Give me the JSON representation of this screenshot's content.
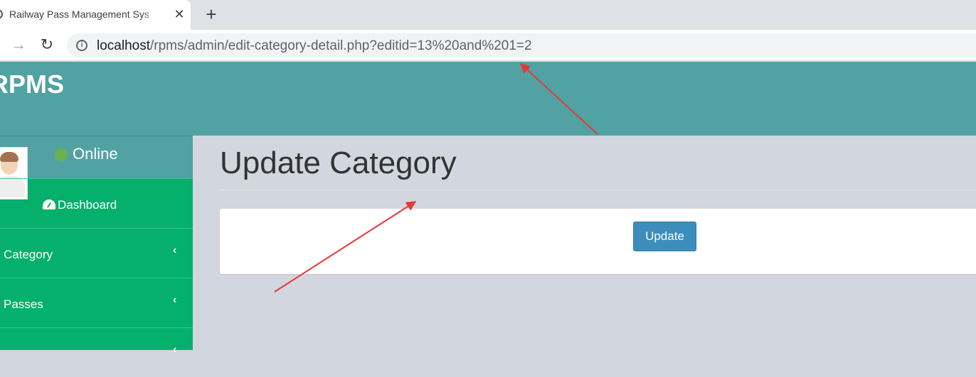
{
  "browser": {
    "tab_title": "Railway Pass Management Sys",
    "tab_close": "✕",
    "new_tab": "+",
    "forward": "→",
    "reload": "↻",
    "info": "i",
    "url_host": "localhost",
    "url_path": "/rpms/admin/edit-category-detail.php?editid=13%20and%201=2"
  },
  "header": {
    "brand": "RPMS"
  },
  "sidebar": {
    "status": "Online",
    "status_color": "#6ab04c",
    "items": [
      {
        "label": "Dashboard",
        "icon": "dashboard-icon"
      },
      {
        "label": "Category",
        "chevron": "‹"
      },
      {
        "label": "Passes",
        "chevron": "‹"
      },
      {
        "label": "",
        "chevron": "‹"
      }
    ]
  },
  "main": {
    "title": "Update Category",
    "update_label": "Update"
  },
  "colors": {
    "header": "#52a2a4",
    "sidebar": "#05b06c",
    "button": "#3c8dbc",
    "annotation": "#e53935"
  }
}
